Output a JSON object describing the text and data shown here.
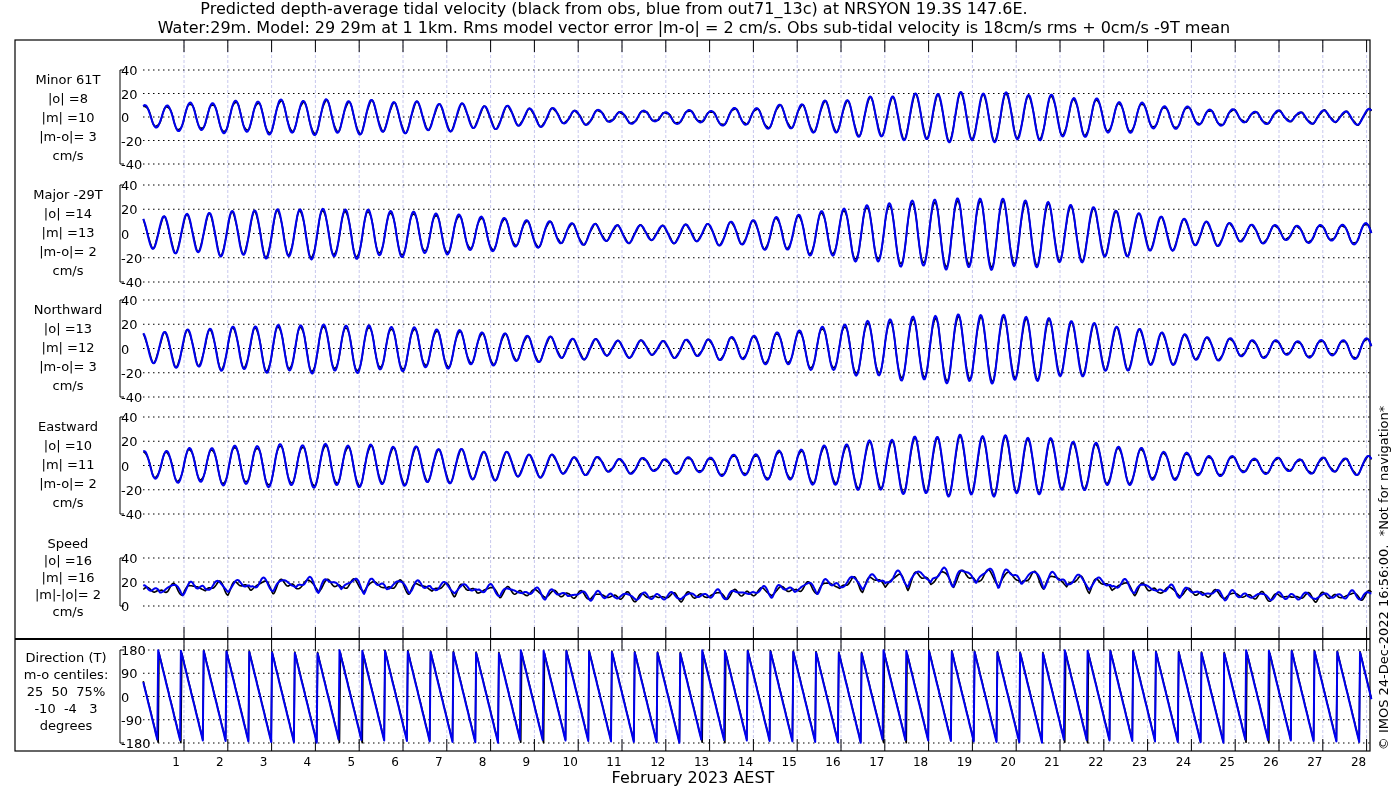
{
  "title": [
    "Predicted depth-average tidal velocity (black from obs, blue from out71_13c) at NRSYON 19.3S 147.6E.",
    "Water:29m. Model: 29 29m at 1 1km. Rms model vector error |m-o| = 2 cm/s. Obs sub-tidal velocity is 18cm/s rms + 0cm/s -9T mean"
  ],
  "panels": [
    {
      "kind": "velocity",
      "label": [
        "Minor 61T",
        "|o| =8",
        "|m| =10",
        "|m-o|= 3",
        "cm/s"
      ],
      "yticks": [
        "40",
        "20",
        "0",
        "-20",
        "-40"
      ]
    },
    {
      "kind": "velocity",
      "label": [
        "Major -29T",
        "|o| =14",
        "|m| =13",
        "|m-o|= 2",
        "cm/s"
      ],
      "yticks": [
        "40",
        "20",
        "0",
        "-20",
        "-40"
      ]
    },
    {
      "kind": "velocity",
      "label": [
        "Northward",
        "|o| =13",
        "|m| =12",
        "|m-o|= 3",
        "cm/s"
      ],
      "yticks": [
        "40",
        "20",
        "0",
        "-20",
        "-40"
      ]
    },
    {
      "kind": "velocity",
      "label": [
        "Eastward",
        "|o| =10",
        "|m| =11",
        "|m-o|= 2",
        "cm/s"
      ],
      "yticks": [
        "40",
        "20",
        "0",
        "-20",
        "-40"
      ]
    },
    {
      "kind": "speed",
      "label": [
        "Speed",
        "|o| =16",
        "|m| =16",
        "|m|-|o|= 2",
        "cm/s"
      ],
      "yticks": [
        "40",
        "20",
        "0"
      ]
    },
    {
      "kind": "direction",
      "label": [
        "Direction (T)",
        "m-o centiles:",
        "25  50  75%",
        "-10  -4   3",
        "degrees"
      ],
      "yticks": [
        "180",
        "90",
        "0",
        "-90",
        "-180"
      ]
    }
  ],
  "x_axis": {
    "ticks": [
      "1",
      "2",
      "3",
      "4",
      "5",
      "6",
      "7",
      "8",
      "9",
      "10",
      "11",
      "12",
      "13",
      "14",
      "15",
      "16",
      "17",
      "18",
      "19",
      "20",
      "21",
      "22",
      "23",
      "24",
      "25",
      "26",
      "27",
      "28"
    ],
    "label": "February 2023 AEST"
  },
  "footer": "© IMOS 24-Dec-2022 16:56:00.  *Not for navigation*"
}
